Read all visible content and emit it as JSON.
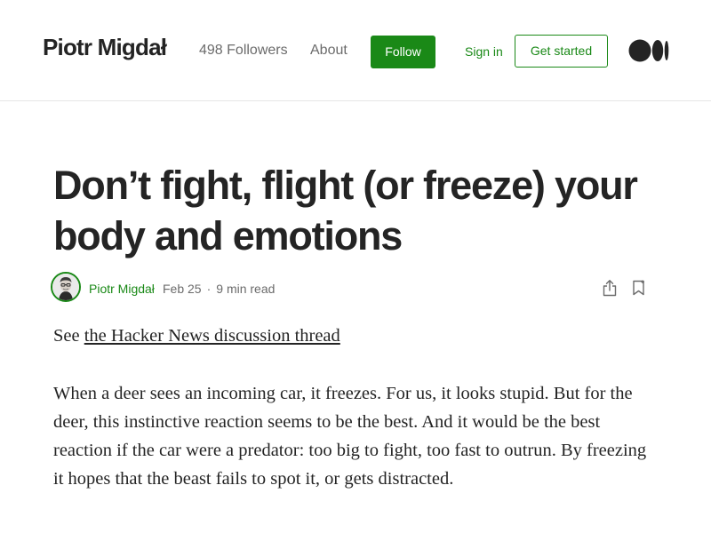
{
  "header": {
    "brand": "Piotr Migdał",
    "followers": "498 Followers",
    "about": "About",
    "follow": "Follow",
    "sign_in": "Sign in",
    "get_started": "Get started",
    "logo_icon": "medium-logo-icon"
  },
  "article": {
    "title": "Don’t fight, flight (or freeze) your body and emotions",
    "author": "Piotr Migdał",
    "date": "Feb 25",
    "separator": "·",
    "read_time": "9 min read",
    "intro_prefix": "See ",
    "intro_link": "the Hacker News discussion thread",
    "paragraph_1": "When a deer sees an incoming car, it freezes. For us, it looks stupid. But for the deer, this instinctive reaction seems to be the best. And it would be the best reaction if the car were a predator: too big to fight, too fast to outrun. By freezing it hopes that the beast fails to spot it, or gets distracted."
  },
  "colors": {
    "accent": "#1a8917",
    "text": "#242424",
    "muted": "#6b6b6b",
    "divider": "#e6e6e6"
  },
  "icons": {
    "share": "share-icon",
    "bookmark": "bookmark-icon",
    "avatar": "author-avatar"
  }
}
